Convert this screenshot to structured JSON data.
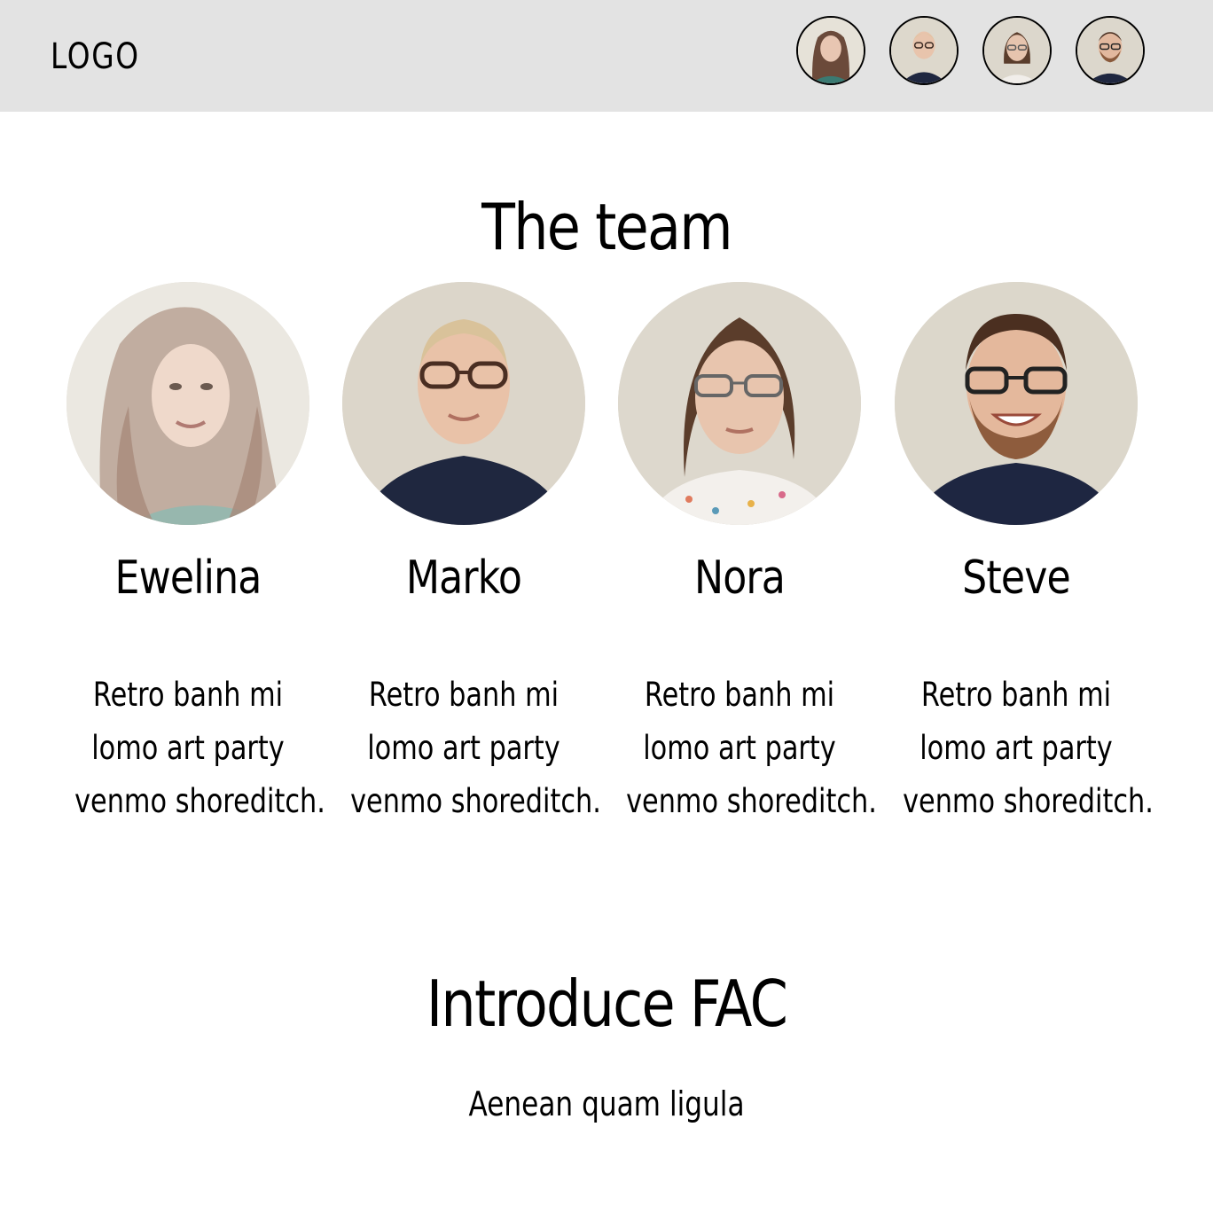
{
  "header": {
    "logo": "LOGO",
    "nav_avatars": [
      {
        "name": "Ewelina",
        "icon": "avatar-ewelina"
      },
      {
        "name": "Marko",
        "icon": "avatar-marko"
      },
      {
        "name": "Nora",
        "icon": "avatar-nora"
      },
      {
        "name": "Steve",
        "icon": "avatar-steve"
      }
    ]
  },
  "team": {
    "title": "The team",
    "members": [
      {
        "name": "Ewelina",
        "bio": [
          "Retro banh mi",
          "lomo art party",
          "venmo shoreditch."
        ]
      },
      {
        "name": "Marko",
        "bio": [
          "Retro banh mi",
          "lomo art party",
          "venmo shoreditch."
        ]
      },
      {
        "name": "Nora",
        "bio": [
          "Retro banh mi",
          "lomo art party",
          "venmo shoreditch."
        ]
      },
      {
        "name": "Steve",
        "bio": [
          "Retro banh mi",
          "lomo art party",
          "venmo shoreditch."
        ]
      }
    ]
  },
  "fac": {
    "title": "Introduce FAC",
    "subtitle": "Aenean quam ligula"
  },
  "colors": {
    "header_bg": "#e3e3e3",
    "page_bg": "#ffffff",
    "text": "#000000"
  }
}
